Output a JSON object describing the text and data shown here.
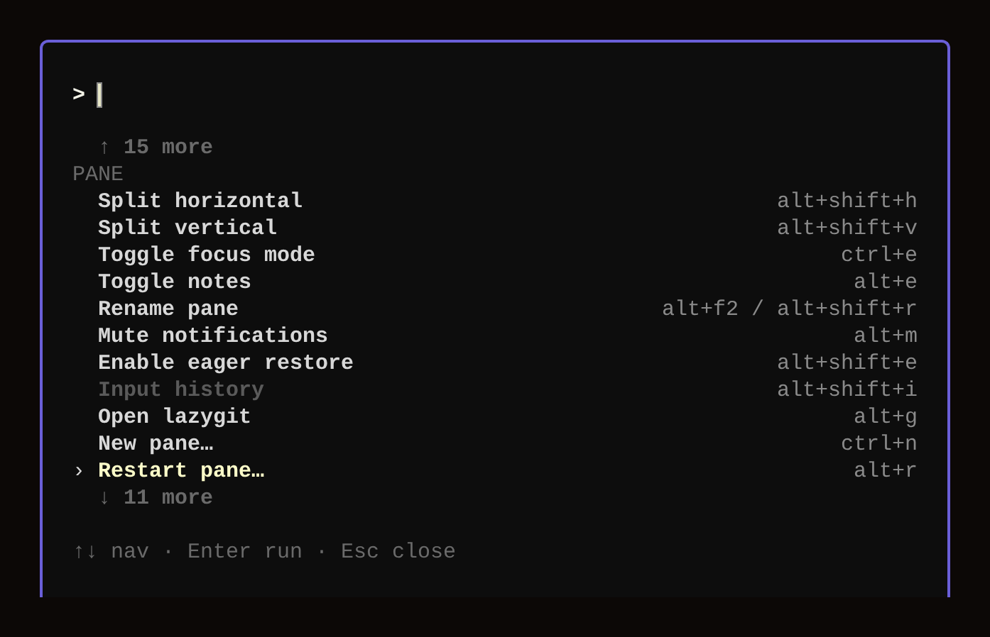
{
  "prompt": {
    "symbol": ">"
  },
  "more_above": "↑ 15 more",
  "section": "PANE",
  "selection_marker": "›",
  "items": [
    {
      "label": "Split horizontal",
      "shortcut": "alt+shift+h",
      "disabled": false,
      "selected": false
    },
    {
      "label": "Split vertical",
      "shortcut": "alt+shift+v",
      "disabled": false,
      "selected": false
    },
    {
      "label": "Toggle focus mode",
      "shortcut": "ctrl+e",
      "disabled": false,
      "selected": false
    },
    {
      "label": "Toggle notes",
      "shortcut": "alt+e",
      "disabled": false,
      "selected": false
    },
    {
      "label": "Rename pane",
      "shortcut": "alt+f2 / alt+shift+r",
      "disabled": false,
      "selected": false
    },
    {
      "label": "Mute notifications",
      "shortcut": "alt+m",
      "disabled": false,
      "selected": false
    },
    {
      "label": "Enable eager restore",
      "shortcut": "alt+shift+e",
      "disabled": false,
      "selected": false
    },
    {
      "label": "Input history",
      "shortcut": "alt+shift+i",
      "disabled": true,
      "selected": false
    },
    {
      "label": "Open lazygit",
      "shortcut": "alt+g",
      "disabled": false,
      "selected": false
    },
    {
      "label": "New pane…",
      "shortcut": "ctrl+n",
      "disabled": false,
      "selected": false
    },
    {
      "label": "Restart pane…",
      "shortcut": "alt+r",
      "disabled": false,
      "selected": true
    }
  ],
  "more_below": "↓ 11 more",
  "footer": "↑↓ nav · Enter run · Esc close"
}
